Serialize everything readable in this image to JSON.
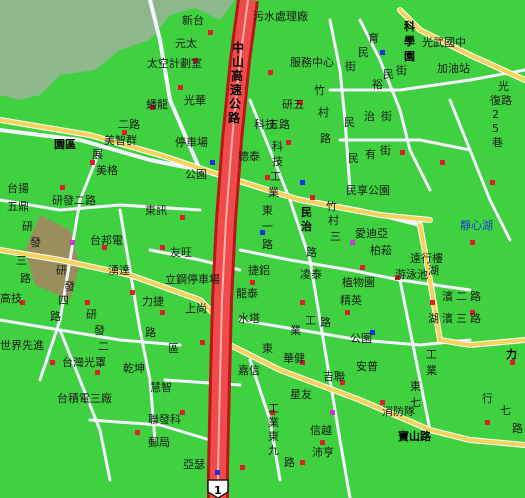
{
  "map": {
    "colors": {
      "land": "#3fd13f",
      "hills": "#8cb88c",
      "park": "#9a8f5c",
      "highway_fill": "#f04a4a",
      "highway_edge": "#b81818",
      "major_road": "#f3d35a",
      "minor_road": "#ffffff"
    },
    "highway": {
      "name_chars": [
        "中",
        "山",
        "高",
        "速",
        "公",
        "路"
      ],
      "shield": "1"
    },
    "places": [
      {
        "id": "xintai",
        "text": "新台"
      },
      {
        "id": "wushui",
        "text": "污水處理廠"
      },
      {
        "id": "kexue",
        "text": "科"
      },
      {
        "id": "xueyuan",
        "text": "學"
      },
      {
        "id": "yuanqu",
        "text": "園"
      },
      {
        "id": "guangwu",
        "text": "光武國中"
      },
      {
        "id": "yuanyuan",
        "text": "元太"
      },
      {
        "id": "taikong",
        "text": "太空計劃室"
      },
      {
        "id": "fuwu",
        "text": "服務中心"
      },
      {
        "id": "jiayou",
        "text": "加油站"
      },
      {
        "id": "guangfu",
        "text": "光"
      },
      {
        "id": "xinlu",
        "text": "復路"
      },
      {
        "id": "panlong",
        "text": "蟠龍"
      },
      {
        "id": "guanghua",
        "text": "光華"
      },
      {
        "id": "yanwu",
        "text": "研五"
      },
      {
        "id": "kexueji",
        "text": "科技"
      },
      {
        "id": "wulu",
        "text": "五路"
      },
      {
        "id": "erlu",
        "text": "二路"
      },
      {
        "id": "tingche",
        "text": "停車場"
      },
      {
        "id": "desheng",
        "text": "德泰"
      },
      {
        "id": "meichang",
        "text": "美智群"
      },
      {
        "id": "yuanqu2",
        "text": "園區"
      },
      {
        "id": "zhan",
        "text": "展"
      },
      {
        "id": "meige",
        "text": "美格"
      },
      {
        "id": "gongyuan",
        "text": "公園"
      },
      {
        "id": "minxiang",
        "text": "民享公園"
      },
      {
        "id": "taige",
        "text": "台揚"
      },
      {
        "id": "wuding",
        "text": "五鼎"
      },
      {
        "id": "yanfaerlu",
        "text": "研發二路"
      },
      {
        "id": "dongshuo",
        "text": "東訊"
      },
      {
        "id": "jingxinhu",
        "text": "靜心湖"
      },
      {
        "id": "aiyou",
        "text": "愛迪亞"
      },
      {
        "id": "taibang",
        "text": "台邦電"
      },
      {
        "id": "youwang",
        "text": "友旺"
      },
      {
        "id": "gaoji",
        "text": "高技"
      },
      {
        "id": "xinda",
        "text": "湧達"
      },
      {
        "id": "ligang",
        "text": "立鋼停車場"
      },
      {
        "id": "jieyu",
        "text": "捷鋁"
      },
      {
        "id": "lingtai",
        "text": "凌泰"
      },
      {
        "id": "zhiwu",
        "text": "植物園"
      },
      {
        "id": "baisa",
        "text": "柏菘"
      },
      {
        "id": "yongxing",
        "text": "遠行樓"
      },
      {
        "id": "youyong",
        "text": "游泳池"
      },
      {
        "id": "jingying",
        "text": "精英"
      },
      {
        "id": "longtai",
        "text": "龍泰"
      },
      {
        "id": "lijian",
        "text": "力捷"
      },
      {
        "id": "shangshang",
        "text": "上尚"
      },
      {
        "id": "shuita",
        "text": "水塔"
      },
      {
        "id": "gongyuan2",
        "text": "公園"
      },
      {
        "id": "shijie",
        "text": "世界先進"
      },
      {
        "id": "taiwanguang",
        "text": "台灣光罩"
      },
      {
        "id": "qiankun",
        "text": "乾坤"
      },
      {
        "id": "huajian",
        "text": "華健"
      },
      {
        "id": "anpu",
        "text": "安普"
      },
      {
        "id": "huizhi",
        "text": "慧智"
      },
      {
        "id": "jiaxin",
        "text": "嘉信"
      },
      {
        "id": "jilian",
        "text": "吉聯"
      },
      {
        "id": "taijidian",
        "text": "台積電三廠"
      },
      {
        "id": "xingyou",
        "text": "星友"
      },
      {
        "id": "xiaofang",
        "text": "消防隊"
      },
      {
        "id": "lianfa",
        "text": "聯發科"
      },
      {
        "id": "xinda2",
        "text": "信越"
      },
      {
        "id": "youju",
        "text": "郵局"
      },
      {
        "id": "yase",
        "text": "亞瑟"
      },
      {
        "id": "peiheng",
        "text": "沛亨"
      },
      {
        "id": "li",
        "text": "力"
      },
      {
        "id": "baoshan",
        "text": "寶山路"
      }
    ],
    "roads": [
      {
        "id": "wufu",
        "chars": [
          "五",
          "福",
          "路"
        ]
      },
      {
        "id": "yanxin",
        "chars": [
          "研",
          "發",
          "五",
          "路"
        ]
      },
      {
        "id": "zhucun",
        "chars": [
          "竹",
          "村",
          "路"
        ]
      },
      {
        "id": "yuming",
        "chars": [
          "育",
          "民",
          "街"
        ]
      },
      {
        "id": "yu",
        "chars": [
          "裕",
          "民",
          "街"
        ]
      },
      {
        "id": "minyou",
        "chars": [
          "民",
          "有",
          "街"
        ]
      },
      {
        "id": "minzhi",
        "chars": [
          "民",
          "治",
          "街"
        ]
      },
      {
        "id": "yuanqu2lu",
        "chars": [
          "園",
          "區",
          "二",
          "路"
        ]
      },
      {
        "id": "kegong",
        "chars": [
          "科",
          "技",
          "工",
          "業",
          "東",
          "一",
          "路"
        ]
      },
      {
        "id": "zhucun2",
        "chars": [
          "竹",
          "村",
          "三",
          "路"
        ]
      },
      {
        "id": "yuanqu3",
        "chars": [
          "園",
          "區",
          "三",
          "路"
        ]
      },
      {
        "id": "yanfa4",
        "chars": [
          "研",
          "發",
          "四",
          "路"
        ]
      },
      {
        "id": "yanfa3",
        "chars": [
          "研",
          "發",
          "三",
          "路"
        ]
      },
      {
        "id": "yanfa2",
        "chars": [
          "研",
          "發",
          "二",
          "路"
        ]
      },
      {
        "id": "huqiao2",
        "chars": [
          "湖",
          "濱",
          "二",
          "路"
        ]
      },
      {
        "id": "huqiao3",
        "chars": [
          "湖",
          "濱",
          "三",
          "路"
        ]
      },
      {
        "id": "dongyilu",
        "chars": [
          "東",
          "業",
          "工",
          "路"
        ]
      },
      {
        "id": "gongye",
        "chars": [
          "工",
          "業",
          "東",
          "九",
          "路"
        ]
      },
      {
        "id": "gongye7",
        "chars": [
          "工",
          "業",
          "東",
          "七",
          "路"
        ]
      },
      {
        "id": "xingye",
        "chars": [
          "行",
          "七",
          "路"
        ]
      },
      {
        "id": "zhongmei",
        "chars": [
          "中",
          "華",
          "路"
        ]
      },
      {
        "id": "guangfulu",
        "chars": [
          "2",
          "5",
          "巷"
        ]
      }
    ]
  }
}
